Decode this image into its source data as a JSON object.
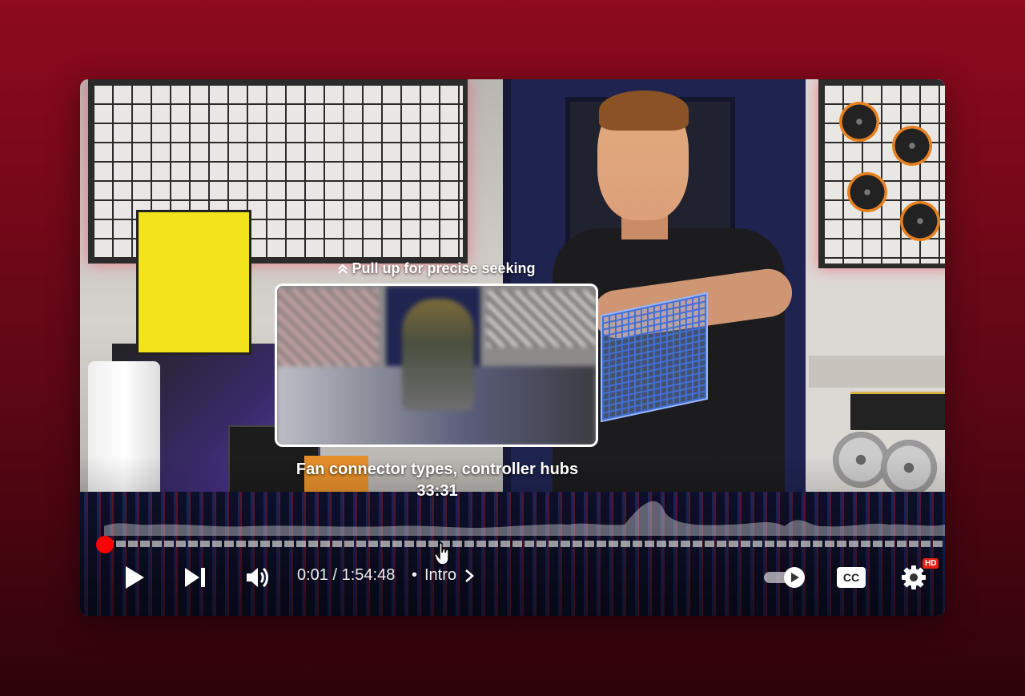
{
  "player": {
    "seek_hint": "Pull up for precise seeking",
    "chapter_preview": {
      "title": "Fan connector types, controller hubs",
      "timestamp": "33:31"
    },
    "time_display": "0:01 / 1:54:48",
    "separator": "•",
    "current_chapter": "Intro",
    "quality_badge": "HD",
    "progress_fraction": 0.0001,
    "accent_color": "#ff0000",
    "icons": [
      "play-icon",
      "next-icon",
      "volume-icon",
      "chevron-right-icon",
      "autoplay-toggle-icon",
      "captions-icon",
      "settings-icon",
      "double-chevron-up-icon",
      "hand-cursor-icon"
    ]
  }
}
